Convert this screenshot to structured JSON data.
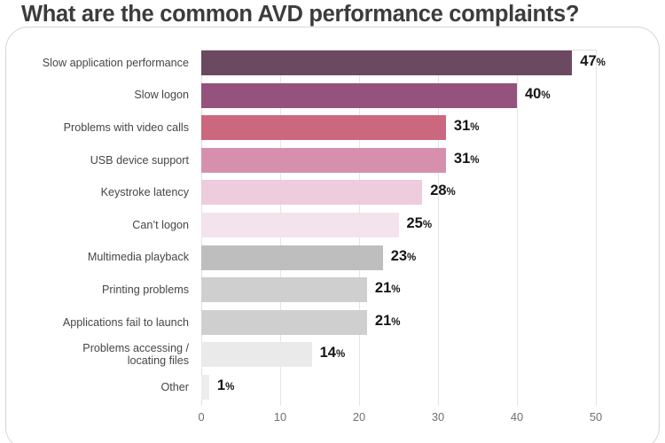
{
  "title": "What are the common AVD performance complaints?",
  "chart_data": {
    "type": "bar",
    "orientation": "horizontal",
    "title": "What are the common AVD performance complaints?",
    "xlabel": "",
    "ylabel": "",
    "xlim": [
      0,
      50
    ],
    "xticks": [
      0,
      10,
      20,
      30,
      40,
      50
    ],
    "xtick_labels": [
      "0",
      "10",
      "20",
      "30",
      "40",
      "50"
    ],
    "grid": "vertical",
    "legend": "none",
    "value_suffix": "%",
    "categories": [
      "Slow application performance",
      "Slow logon",
      "Problems with video calls",
      "USB device support",
      "Keystroke latency",
      "Can’t logon",
      "Multimedia playback",
      "Printing problems",
      "Applications fail to launch",
      "Problems accessing /\nlocating files",
      "Other"
    ],
    "values": [
      47,
      40,
      31,
      31,
      28,
      25,
      23,
      21,
      21,
      14,
      1
    ],
    "value_labels": [
      "47",
      "40",
      "31",
      "31",
      "28",
      "25",
      "23",
      "21",
      "21",
      "14",
      "1"
    ],
    "colors": [
      "#6b4a61",
      "#95527d",
      "#cb6880",
      "#d690ad",
      "#eecbdd",
      "#f3e3ec",
      "#bebebe",
      "#cfcfcf",
      "#cfcfcf",
      "#eaeaea",
      "#ededed"
    ]
  },
  "style": {
    "title_color": "#3c3c3c",
    "label_color": "#464646",
    "tick_color": "#6f6f6f",
    "value_color": "#151515",
    "grid_color": "#e4e4e4",
    "card_border_color": "#d6d6d6",
    "background": "#ffffff"
  }
}
